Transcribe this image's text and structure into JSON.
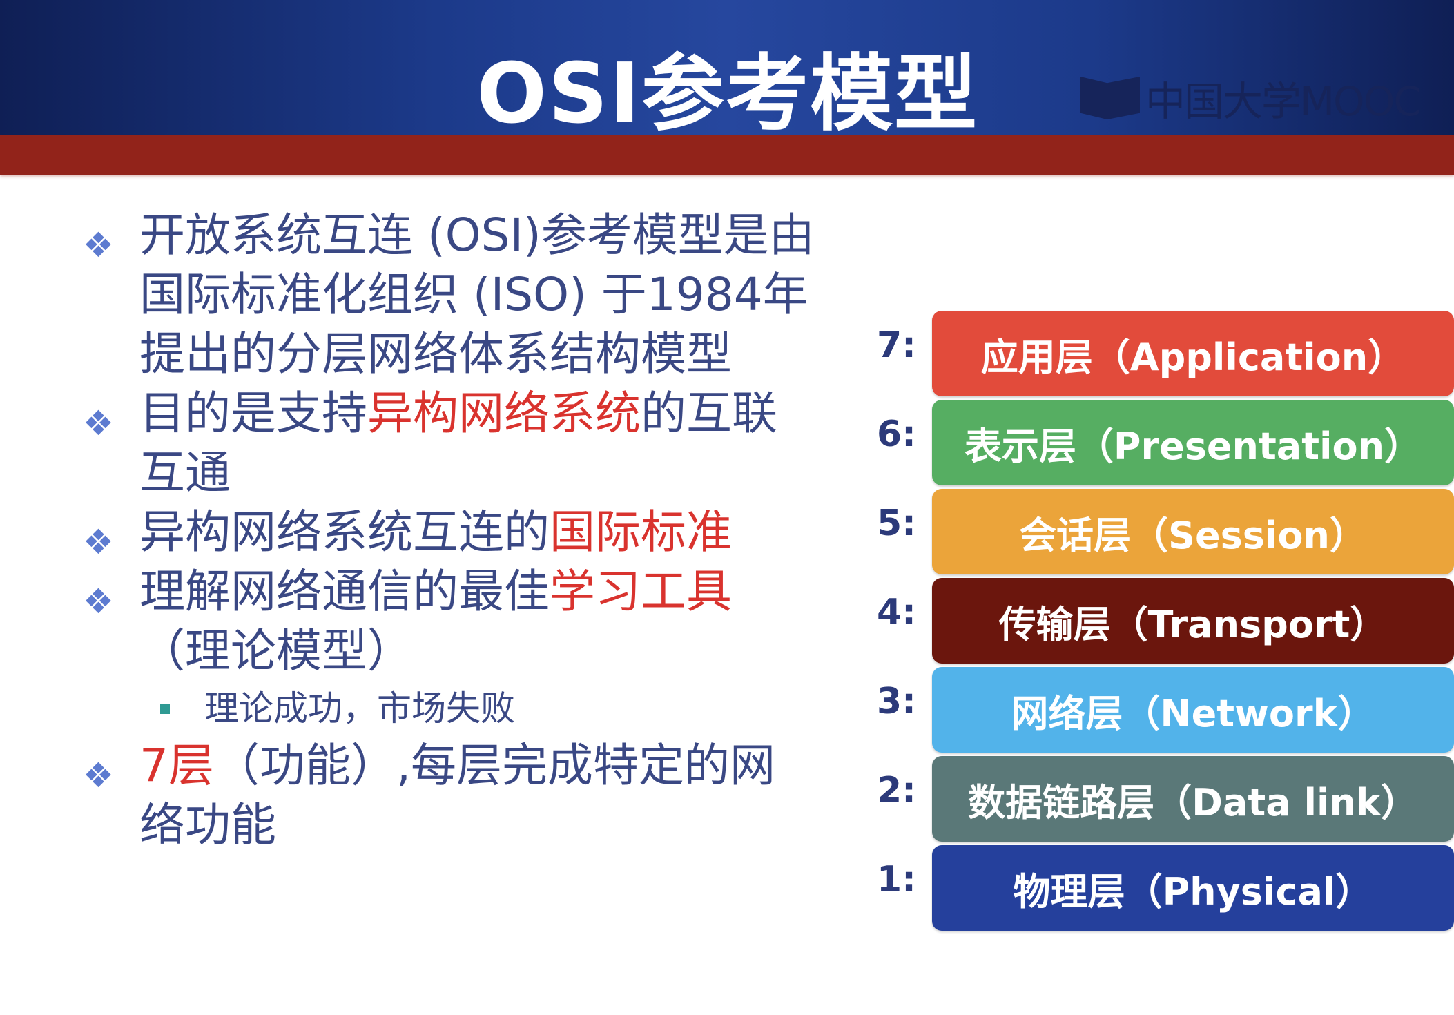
{
  "header": {
    "title": "OSI参考模型",
    "logo": "中国大学MOOC"
  },
  "bullets": [
    {
      "segments": [
        {
          "text": "开放系统互连 (OSI)参考模型是由国际标准化组织 (ISO) 于1984年提出的分层网络体系结构模型",
          "red": false
        }
      ]
    },
    {
      "segments": [
        {
          "text": "目的是支持",
          "red": false
        },
        {
          "text": "异构网络系统",
          "red": true
        },
        {
          "text": "的互联互通",
          "red": false
        }
      ]
    },
    {
      "segments": [
        {
          "text": "异构网络系统互连的",
          "red": false
        },
        {
          "text": "国际标准",
          "red": true
        }
      ]
    },
    {
      "segments": [
        {
          "text": "理解网络通信的最佳",
          "red": false
        },
        {
          "text": "学习工具",
          "red": true
        },
        {
          "text": "（理论模型）",
          "red": false
        }
      ],
      "sub": "理论成功，市场失败"
    },
    {
      "segments": [
        {
          "text": "7层",
          "red": true
        },
        {
          "text": "（功能）,每层完成特定的网络功能",
          "red": false
        }
      ]
    }
  ],
  "layers": [
    {
      "num": "7:",
      "label": "应用层（Application）",
      "color": "#e24b3b"
    },
    {
      "num": "6:",
      "label": "表示层（Presentation）",
      "color": "#56ae62"
    },
    {
      "num": "5:",
      "label": "会话层（Session）",
      "color": "#eba43a"
    },
    {
      "num": "4:",
      "label": "传输层（Transport）",
      "color": "#6b160d"
    },
    {
      "num": "3:",
      "label": "网络层（Network）",
      "color": "#52b3ea"
    },
    {
      "num": "2:",
      "label": "数据链路层（Data link）",
      "color": "#5a7878"
    },
    {
      "num": "1:",
      "label": "物理层（Physical）",
      "color": "#25409c"
    }
  ]
}
